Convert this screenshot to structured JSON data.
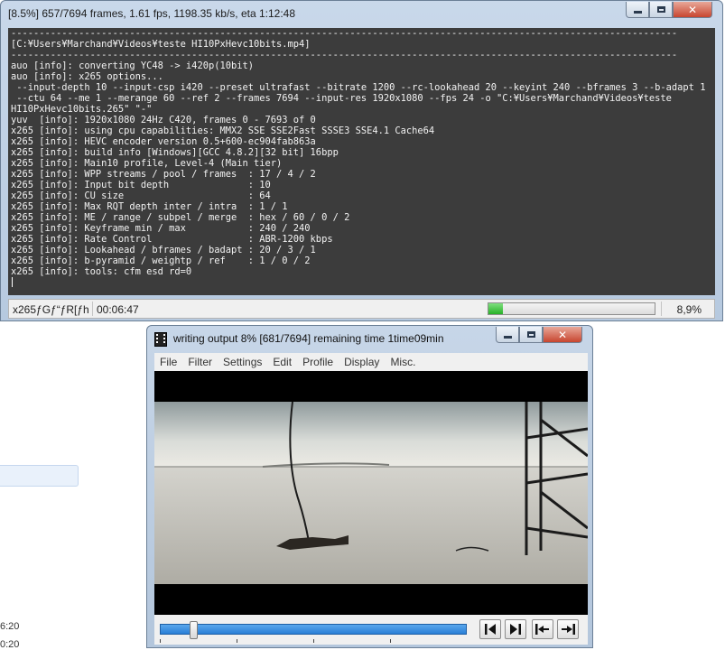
{
  "console_window": {
    "title": "[8.5%] 657/7694 frames, 1.61 fps, 1198.35 kb/s, eta 1:12:48",
    "lines": [
      "----------------------------------------------------------------------------------------------------------------------",
      "[C:¥Users¥Marchand¥Videos¥teste HI10PxHevc10bits.mp4]",
      "----------------------------------------------------------------------------------------------------------------------",
      "auo [info]: converting YC48 -> i420p(10bit)",
      "auo [info]: x265 options...",
      " --input-depth 10 --input-csp i420 --preset ultrafast --bitrate 1200 --rc-lookahead 20 --keyint 240 --bframes 3 --b-adapt 1",
      " --ctu 64 --me 1 --merange 60 --ref 2 --frames 7694 --input-res 1920x1080 --fps 24 -o \"C:¥Users¥Marchand¥Videos¥teste",
      "HI10PxHevc10bits.265\" \"-\"",
      "yuv  [info]: 1920x1080 24Hz C420, frames 0 - 7693 of 0",
      "x265 [info]: using cpu capabilities: MMX2 SSE SSE2Fast SSSE3 SSE4.1 Cache64",
      "x265 [info]: HEVC encoder version 0.5+600-ec904fab863a",
      "x265 [info]: build info [Windows][GCC 4.8.2][32 bit] 16bpp",
      "x265 [info]: Main10 profile, Level-4 (Main tier)",
      "x265 [info]: WPP streams / pool / frames  : 17 / 4 / 2",
      "x265 [info]: Input bit depth              : 10",
      "x265 [info]: CU size                      : 64",
      "x265 [info]: Max RQT depth inter / intra  : 1 / 1",
      "x265 [info]: ME / range / subpel / merge  : hex / 60 / 0 / 2",
      "x265 [info]: Keyframe min / max           : 240 / 240",
      "x265 [info]: Rate Control                 : ABR-1200 kbps",
      "x265 [info]: Lookahead / bframes / badapt : 20 / 3 / 1",
      "x265 [info]: b-pyramid / weightp / ref    : 1 / 0 / 2",
      "x265 [info]: tools: cfm esd rd=0"
    ],
    "status": {
      "label": "x265ƒGƒ“ƒR[ƒh",
      "elapsed": "00:06:47",
      "progress_fraction": 0.089,
      "percent_text": "8,9%"
    }
  },
  "preview_window": {
    "title": "writing output 8% [681/7694]  remaining time 1time09min",
    "menu": [
      "File",
      "Filter",
      "Settings",
      "Edit",
      "Profile",
      "Display",
      "Misc."
    ],
    "seek_position_fraction": 0.1
  },
  "background": {
    "times": [
      "6:20",
      "0:20"
    ]
  },
  "colors": {
    "console_bg": "#3c3c3c",
    "console_text": "#f2f2f2",
    "progress_green": "#27b127",
    "seek_blue": "#2a7fd6"
  }
}
